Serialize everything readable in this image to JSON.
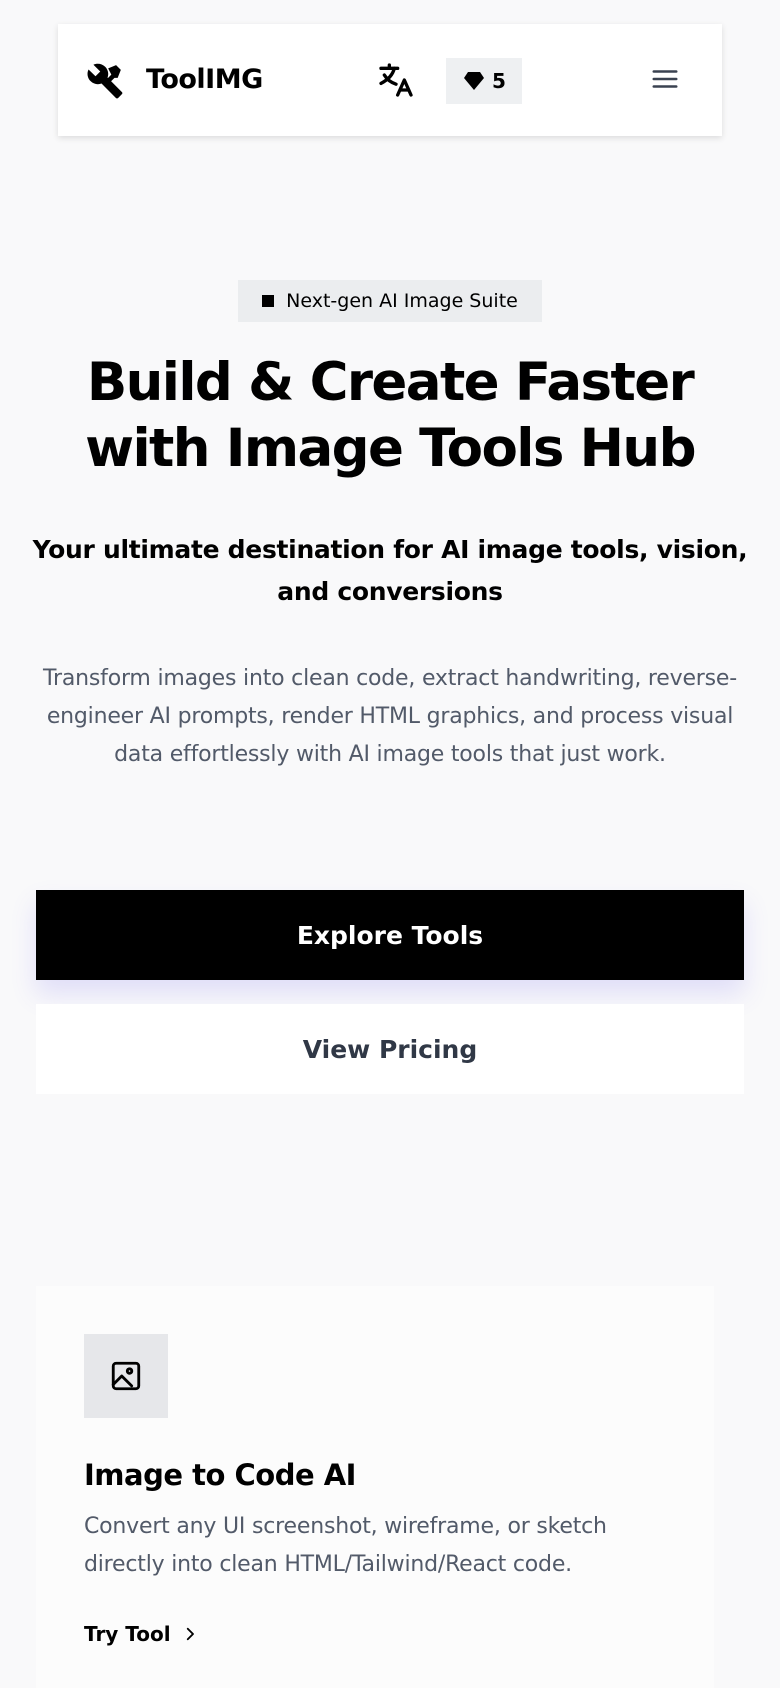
{
  "header": {
    "brand": "ToolIMG",
    "credits": "5",
    "icons": [
      "tools-icon",
      "translate-icon",
      "diamond-icon",
      "menu-icon"
    ]
  },
  "hero": {
    "badge": "Next-gen AI Image Suite",
    "title": "Build & Create Faster with Image Tools Hub",
    "subtitle": "Your ultimate destination for AI image tools, vision, and conversions",
    "description": "Transform images into clean code, extract handwriting, reverse-engineer AI prompts, render HTML graphics, and process visual data effortlessly with AI image tools that just work.",
    "primary_button": "Explore Tools",
    "secondary_button": "View Pricing"
  },
  "tools": [
    {
      "icon": "image-icon",
      "title": "Image to Code AI",
      "description": "Convert any UI screenshot, wireframe, or sketch directly into clean HTML/Tailwind/React code.",
      "link_label": "Try Tool"
    }
  ],
  "colors": {
    "background": "#f9f9fa",
    "primary": "#000000",
    "muted_text": "#525a69",
    "badge_bg": "#ebedef"
  }
}
